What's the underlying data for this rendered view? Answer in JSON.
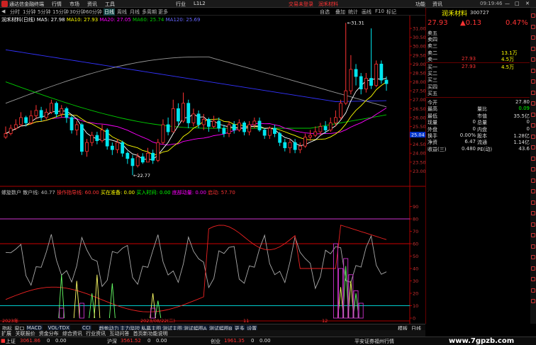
{
  "app": {
    "title": "通达信金融终端",
    "menus": [
      "行情",
      "市场",
      "资讯",
      "工具",
      "行业",
      "L1L2"
    ],
    "promo1": "交易未登录",
    "promo2": "润禾材料",
    "sys": [
      "功能",
      "资讯"
    ],
    "clock": "09:19:46"
  },
  "toolbar": {
    "items": [
      "分时",
      "1分钟",
      "5分钟",
      "15分钟",
      "30分钟",
      "60分钟",
      "日线",
      "周线",
      "月线",
      "多周期",
      "更多"
    ],
    "right": [
      "自选",
      "叠加",
      "统计",
      "画线",
      "F10",
      "标记"
    ]
  },
  "legend_top": {
    "title": "润禾材料(日线)",
    "ma5": "MA5: 27.98",
    "ma10": "MA10: 27.93",
    "ma20": "MA20: 27.05",
    "ma60": "MA60: 25.74",
    "ma120": "MA120: 25.69"
  },
  "legend_bottom": {
    "a": "螺旋数户 散户线: 40.77",
    "b": "操作指导线: 60.00",
    "c": "买在准备: 0.00",
    "d": "买入时间: 0.00",
    "e": "底部动量: 0.00",
    "f": "启动: 57.70"
  },
  "colors": {
    "up": "#ff3333",
    "down": "#00e5ee",
    "ma5": "#ffffff",
    "ma10": "#ffff00",
    "ma20": "#ff00ff",
    "ma60": "#00cc00",
    "ma120": "#3333ff"
  },
  "chart_data": [
    {
      "type": "line",
      "title": "润禾材料(日线)",
      "y_ticks": [
        "31.00",
        "30.50",
        "30.00",
        "29.50",
        "29.00",
        "28.50",
        "28.00",
        "27.50",
        "27.00",
        "26.50",
        "26.00",
        "25.50",
        "25.00",
        "24.50",
        "24.00",
        "23.50",
        "23.00"
      ],
      "ylim": [
        22.5,
        31.4
      ],
      "annotations": [
        "31.31",
        "22.77"
      ],
      "price_tag": "25.04"
    },
    {
      "type": "line",
      "title": "螺旋数户",
      "y_ticks": [
        "90",
        "80",
        "70",
        "60",
        "50",
        "40",
        "30",
        "20",
        "10",
        "0"
      ],
      "ylim": [
        0,
        100
      ],
      "reference_lines": [
        80,
        60,
        10
      ]
    }
  ],
  "xaxis": {
    "labels": [
      "2023年",
      "2023/08/22(二)",
      "11",
      "12"
    ]
  },
  "quote": {
    "name": "润禾材料",
    "code": "300727",
    "price": "27.93",
    "change": "▲0.13",
    "pct": "0.47%"
  },
  "orderbook": {
    "asks": [
      {
        "label": "卖五",
        "price": "",
        "vol": ""
      },
      {
        "label": "卖四",
        "price": "",
        "vol": ""
      },
      {
        "label": "卖三",
        "price": "",
        "vol": ""
      },
      {
        "label": "卖二",
        "price": "",
        "vol": "13.1万"
      },
      {
        "label": "卖一",
        "price": "27.93",
        "vol": "4.5万"
      }
    ],
    "bids": [
      {
        "label": "买一",
        "price": "27.93",
        "vol": "4.5万"
      },
      {
        "label": "买二",
        "price": "",
        "vol": ""
      },
      {
        "label": "买三",
        "price": "",
        "vol": ""
      },
      {
        "label": "买四",
        "price": "",
        "vol": ""
      },
      {
        "label": "买五",
        "price": "",
        "vol": ""
      }
    ]
  },
  "stats": [
    {
      "l1": "今开",
      "v1": "",
      "l2": "",
      "v2": "27.80"
    },
    {
      "l1": "最高",
      "v1": "",
      "l2": "量比",
      "v2": "0.09"
    },
    {
      "l1": "最低",
      "v1": "",
      "l2": "市值",
      "v2": "35.5亿"
    },
    {
      "l1": "现量",
      "v1": "0",
      "l2": "总量",
      "v2": "0"
    },
    {
      "l1": "外盘",
      "v1": "0",
      "l2": "内盘",
      "v2": "0"
    },
    {
      "l1": "换手",
      "v1": "0.00%",
      "l2": "股本",
      "v2": "1.28亿"
    },
    {
      "l1": "净资",
      "v1": "6.47",
      "l2": "流通",
      "v2": "1.14亿"
    },
    {
      "l1": "收益(三)",
      "v1": "0.480",
      "l2": "PE(动)",
      "v2": "43.6"
    }
  ],
  "tabs": [
    "指标",
    "窗口",
    "MACD",
    "VOL-TDX",
    "CCI",
    "趋势动力",
    "主力监控",
    "私募主图",
    "测试主图",
    "测试幅图A",
    "测试幅图B",
    "更多",
    "设置"
  ],
  "tabs_right": [
    "模板",
    "日线"
  ],
  "tabs2": [
    "扩展",
    "关联报价",
    "资金分布",
    "综合资讯",
    "行业资讯",
    "互动问答",
    "首页新功能说明"
  ],
  "status": {
    "items": [
      {
        "name": "上证",
        "val": "3061.86",
        "chg": "0",
        "vol": "0.00"
      },
      {
        "name": "沪深",
        "val": "3561.52",
        "chg": "0",
        "vol": "0.00"
      },
      {
        "name": "创业",
        "val": "1961.35",
        "chg": "0",
        "vol": "0.00"
      }
    ],
    "broker": "平安证券福州行情",
    "watermark": "www.7gpzb.com"
  }
}
